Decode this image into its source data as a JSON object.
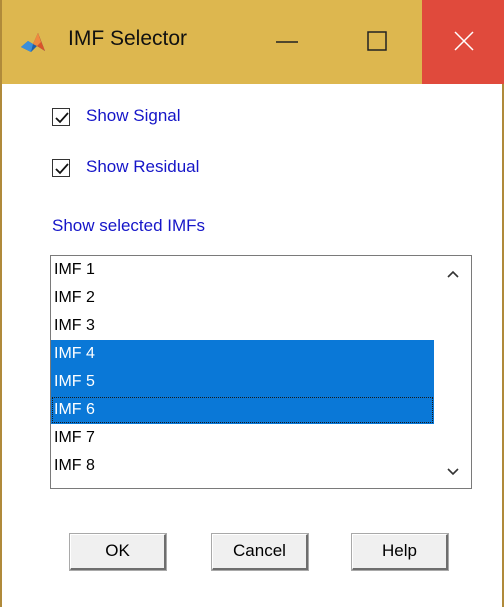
{
  "window": {
    "title": "IMF Selector",
    "controls": {
      "minimize": "minimize-icon",
      "maximize": "maximize-icon",
      "close": "close-icon"
    },
    "app_icon": "matlab-icon"
  },
  "options": {
    "show_signal": {
      "label": "Show Signal",
      "checked": true
    },
    "show_residual": {
      "label": "Show Residual",
      "checked": true
    }
  },
  "imf_list": {
    "heading": "Show selected IMFs",
    "items": [
      {
        "label": "IMF 1",
        "selected": false
      },
      {
        "label": "IMF 2",
        "selected": false
      },
      {
        "label": "IMF 3",
        "selected": false
      },
      {
        "label": "IMF 4",
        "selected": true
      },
      {
        "label": "IMF 5",
        "selected": true
      },
      {
        "label": "IMF 6",
        "selected": true,
        "focused": true
      },
      {
        "label": "IMF 7",
        "selected": false
      },
      {
        "label": "IMF 8",
        "selected": false
      }
    ]
  },
  "buttons": {
    "ok": "OK",
    "cancel": "Cancel",
    "help": "Help"
  },
  "colors": {
    "titlebar": "#ddb74f",
    "close_button": "#e04a3c",
    "label_text": "#1515c8",
    "selection": "#0a78d7"
  }
}
